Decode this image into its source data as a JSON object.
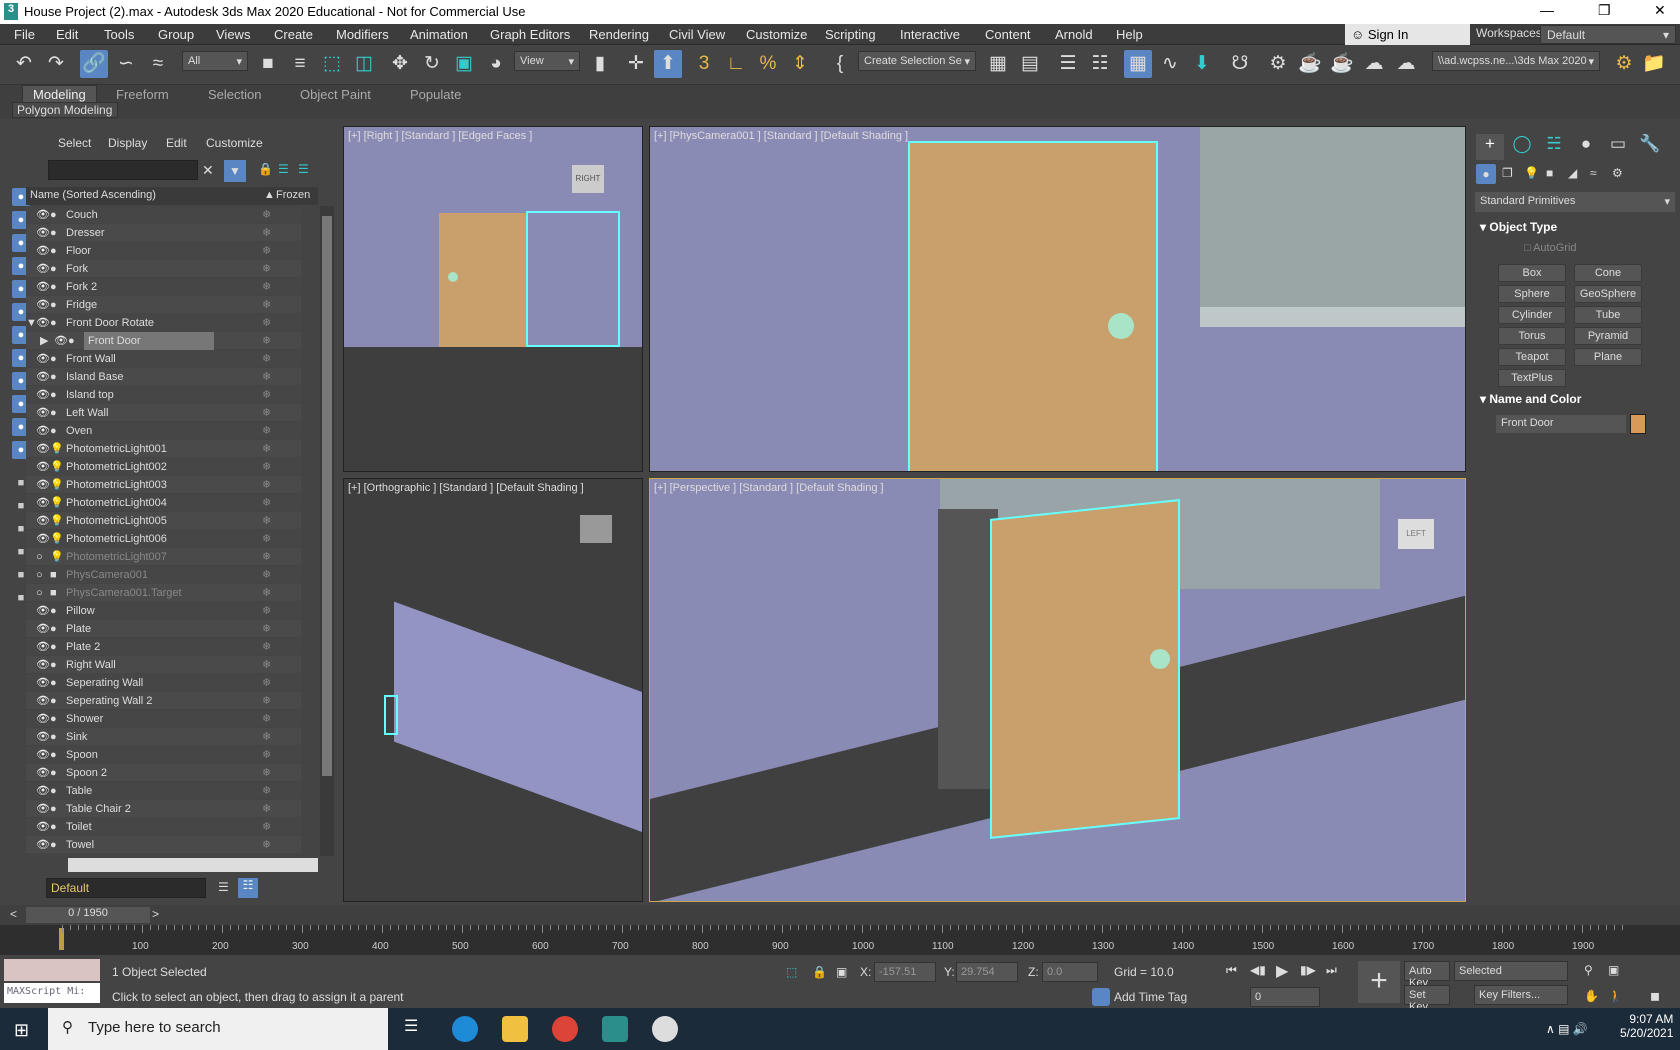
{
  "window": {
    "title": "House Project (2).max - Autodesk 3ds Max 2020 Educational - Not for Commercial Use",
    "app_icon": "3"
  },
  "menu": [
    "File",
    "Edit",
    "Tools",
    "Group",
    "Views",
    "Create",
    "Modifiers",
    "Animation",
    "Graph Editors",
    "Rendering",
    "Civil View",
    "Customize",
    "Scripting",
    "Interactive",
    "Content",
    "Arnold",
    "Help"
  ],
  "signin": "Sign In",
  "workspaces": {
    "label": "Workspaces:",
    "value": "Default"
  },
  "toolbar": {
    "filter": "All",
    "refcoord": "View",
    "selset": "Create Selection Se",
    "project_path": "\\\\ad.wcpss.ne...\\3ds Max 2020"
  },
  "ribbon": {
    "tabs": [
      "Modeling",
      "Freeform",
      "Selection",
      "Object Paint",
      "Populate"
    ],
    "active": "Modeling",
    "panel": "Polygon Modeling"
  },
  "explorer": {
    "menu": [
      "Select",
      "Display",
      "Edit",
      "Customize"
    ],
    "col_name": "Name (Sorted Ascending)",
    "col_frozen": "Frozen",
    "layer": "Default",
    "rows": [
      {
        "name": "Couch",
        "type": "geo"
      },
      {
        "name": "Dresser",
        "type": "geo"
      },
      {
        "name": "Floor",
        "type": "geo"
      },
      {
        "name": "Fork",
        "type": "geo"
      },
      {
        "name": "Fork 2",
        "type": "geo"
      },
      {
        "name": "Fridge",
        "type": "geo"
      },
      {
        "name": "Front Door Rotate",
        "type": "geo",
        "expanded": true
      },
      {
        "name": "Front Door",
        "type": "geo",
        "child": true,
        "selected": true
      },
      {
        "name": "Front Wall",
        "type": "geo"
      },
      {
        "name": "Island Base",
        "type": "geo"
      },
      {
        "name": "Island top",
        "type": "geo"
      },
      {
        "name": "Left Wall",
        "type": "geo"
      },
      {
        "name": "Oven",
        "type": "geo"
      },
      {
        "name": "PhotometricLight001",
        "type": "light"
      },
      {
        "name": "PhotometricLight002",
        "type": "light"
      },
      {
        "name": "PhotometricLight003",
        "type": "light"
      },
      {
        "name": "PhotometricLight004",
        "type": "light"
      },
      {
        "name": "PhotometricLight005",
        "type": "light"
      },
      {
        "name": "PhotometricLight006",
        "type": "light"
      },
      {
        "name": "PhotometricLight007",
        "type": "light",
        "hidden": true
      },
      {
        "name": "PhysCamera001",
        "type": "camera",
        "hidden": true
      },
      {
        "name": "PhysCamera001.Target",
        "type": "camera",
        "hidden": true
      },
      {
        "name": "Pillow",
        "type": "geo"
      },
      {
        "name": "Plate",
        "type": "geo"
      },
      {
        "name": "Plate 2",
        "type": "geo"
      },
      {
        "name": "Right Wall",
        "type": "geo"
      },
      {
        "name": "Seperating Wall",
        "type": "geo"
      },
      {
        "name": "Seperating Wall 2",
        "type": "geo"
      },
      {
        "name": "Shower",
        "type": "geo"
      },
      {
        "name": "Sink",
        "type": "geo"
      },
      {
        "name": "Spoon",
        "type": "geo"
      },
      {
        "name": "Spoon 2",
        "type": "geo"
      },
      {
        "name": "Table",
        "type": "geo"
      },
      {
        "name": "Table Chair 2",
        "type": "geo"
      },
      {
        "name": "Toilet",
        "type": "geo"
      },
      {
        "name": "Towel",
        "type": "geo"
      }
    ]
  },
  "viewports": {
    "top_left": "[+] [Right ] [Standard ] [Edged Faces ]",
    "top_right": "[+] [PhysCamera001 ] [Standard ] [Default Shading ]",
    "bottom_left": "[+] [Orthographic ] [Standard ] [Default Shading ]",
    "bottom_right": "[+] [Perspective ] [Standard ] [Default Shading ]",
    "viewcube_right": "RIGHT",
    "viewcube_persp": "LEFT"
  },
  "command_panel": {
    "category": "Standard Primitives",
    "object_type": "Object Type",
    "autogrid": "AutoGrid",
    "buttons": [
      "Box",
      "Cone",
      "Sphere",
      "GeoSphere",
      "Cylinder",
      "Tube",
      "Torus",
      "Pyramid",
      "Teapot",
      "Plane",
      "TextPlus"
    ],
    "name_color": "Name and Color",
    "object_name": "Front Door",
    "object_color": "#d89a5a"
  },
  "timeline": {
    "frame": "0 / 1950",
    "ticks": [
      "100",
      "200",
      "300",
      "400",
      "500",
      "600",
      "700",
      "800",
      "900",
      "1000",
      "1100",
      "1200",
      "1300",
      "1400",
      "1500",
      "1600",
      "1700",
      "1800",
      "1900"
    ]
  },
  "status": {
    "maxscript": "MAXScript Mi:",
    "selected": "1 Object Selected",
    "prompt": "Click to select an object, then drag to assign it a parent",
    "x_label": "X:",
    "x": "-157.51",
    "y_label": "Y:",
    "y": "29.754",
    "z_label": "Z:",
    "z": "0.0",
    "grid": "Grid = 10.0",
    "add_time_tag": "Add Time Tag",
    "auto_key": "Auto Key",
    "set_key": "Set Key",
    "key_mode": "Selected",
    "key_filters": "Key Filters...",
    "frame": "0"
  },
  "taskbar": {
    "search": "Type here to search",
    "time": "9:07 AM",
    "date": "5/20/2021"
  }
}
